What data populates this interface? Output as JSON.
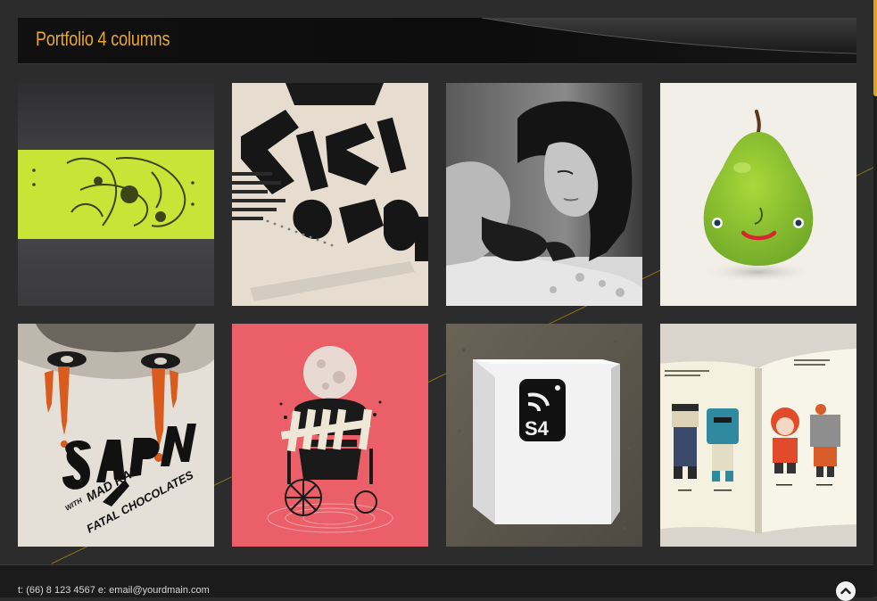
{
  "header": {
    "title": "Portfolio 4 columns"
  },
  "portfolio": {
    "items": [
      {
        "name": "skateboard-artwork"
      },
      {
        "name": "typography-poster"
      },
      {
        "name": "woman-photo"
      },
      {
        "name": "pear-character"
      },
      {
        "name": "sapn-poster"
      },
      {
        "name": "moon-wheelchair-poster"
      },
      {
        "name": "s4-box-photo"
      },
      {
        "name": "character-book"
      }
    ]
  },
  "footer": {
    "phone_label": "t:",
    "phone": "(66) 8 123 4567",
    "email_label": "e:",
    "email": "email@yourdmain.com"
  },
  "icons": {
    "back_to_top": "chevron-up-icon"
  },
  "colors": {
    "accent": "#e8a82a",
    "background": "#2c2c2c",
    "header": "#0f0f0f",
    "footer": "#1b1b1b"
  }
}
